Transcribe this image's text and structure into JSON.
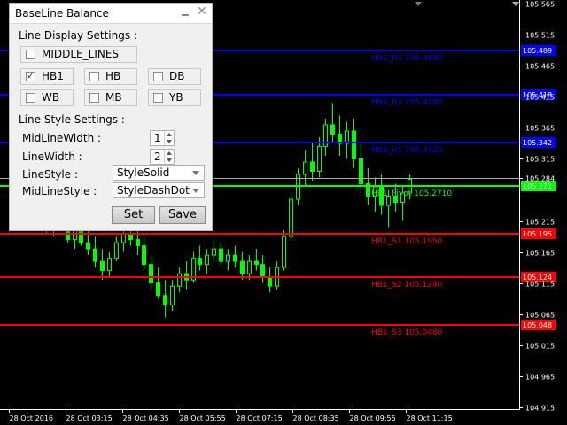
{
  "panel": {
    "title": "BaseLine Balance",
    "display_header": "Line Display Settings :",
    "middle_lines_label": "MIDDLE_LINES",
    "timeframes": [
      {
        "label": "HB1",
        "checked": true
      },
      {
        "label": "HB",
        "checked": false
      },
      {
        "label": "DB",
        "checked": false
      },
      {
        "label": "WB",
        "checked": false
      },
      {
        "label": "MB",
        "checked": false
      },
      {
        "label": "YB",
        "checked": false
      }
    ],
    "style_header": "Line Style Settings :",
    "mid_line_width_label": "MidLineWidth :",
    "mid_line_width_value": "1",
    "line_width_label": "LineWidth :",
    "line_width_value": "2",
    "line_style_label": "LineStyle :",
    "line_style_value": "StyleSolid",
    "mid_line_style_label": "MidLineStyle :",
    "mid_line_style_value": "StyleDashDot",
    "set_label": "Set",
    "save_label": "Save"
  },
  "chart_data": {
    "type": "candlestick",
    "colors": {
      "background": "#000000",
      "candle": "#00ff00",
      "resistance": "#0000ff",
      "pivot": "#00ff00",
      "support": "#ff0000",
      "current": "#aaaaaa"
    },
    "y_ticks": [
      "105.565",
      "105.515",
      "105.465",
      "105.415",
      "105.365",
      "105.315",
      "105.284",
      "105.215",
      "105.165",
      "105.115",
      "105.065",
      "105.015",
      "104.965",
      "104.915"
    ],
    "y_tick_values": [
      105.565,
      105.515,
      105.465,
      105.415,
      105.365,
      105.315,
      105.284,
      105.215,
      105.165,
      105.115,
      105.065,
      105.015,
      104.965,
      104.915
    ],
    "ylim": [
      104.912,
      105.571
    ],
    "x_ticks": [
      "28 Oct 2016",
      "28 Oct 03:15",
      "28 Oct 04:35",
      "28 Oct 05:55",
      "28 Oct 07:15",
      "28 Oct 08:35",
      "28 Oct 09:55",
      "28 Oct 11:15"
    ],
    "levels": [
      {
        "label": "HB1_R3 105.4890",
        "tag": "105.489",
        "value": 105.489,
        "kind": "resistance"
      },
      {
        "label": "HB1_R2 105.4180",
        "tag": "105.418",
        "value": 105.418,
        "kind": "resistance"
      },
      {
        "label": "HB1_R1 105.3420",
        "tag": "105.342",
        "value": 105.342,
        "kind": "resistance"
      },
      {
        "label": "HB1_Pivot 105.2710",
        "tag": "105.271",
        "value": 105.271,
        "kind": "pivot"
      },
      {
        "label": "HB1_S1 105.1950",
        "tag": "105.195",
        "value": 105.195,
        "kind": "support"
      },
      {
        "label": "HB1_S2 105.1240",
        "tag": "105.124",
        "value": 105.124,
        "kind": "support"
      },
      {
        "label": "HB1_S3 105.0480",
        "tag": "105.048",
        "value": 105.048,
        "kind": "support"
      }
    ],
    "current_price": 105.284,
    "candles": [
      [
        105.23,
        105.25,
        105.195,
        105.205
      ],
      [
        105.205,
        105.235,
        105.19,
        105.225
      ],
      [
        105.225,
        105.245,
        105.2,
        105.21
      ],
      [
        105.21,
        105.225,
        105.18,
        105.185
      ],
      [
        105.185,
        105.215,
        105.17,
        105.205
      ],
      [
        105.205,
        105.225,
        105.175,
        105.18
      ],
      [
        105.18,
        105.2,
        105.16,
        105.17
      ],
      [
        105.17,
        105.19,
        105.14,
        105.15
      ],
      [
        105.15,
        105.17,
        105.12,
        105.135
      ],
      [
        105.135,
        105.165,
        105.125,
        105.155
      ],
      [
        105.155,
        105.19,
        105.15,
        105.18
      ],
      [
        105.18,
        105.205,
        105.165,
        105.195
      ],
      [
        105.195,
        105.215,
        105.175,
        105.185
      ],
      [
        105.185,
        105.2,
        105.16,
        105.175
      ],
      [
        105.175,
        105.19,
        105.135,
        105.145
      ],
      [
        105.145,
        105.16,
        105.105,
        105.115
      ],
      [
        105.115,
        105.14,
        105.09,
        105.095
      ],
      [
        105.095,
        105.12,
        105.06,
        105.08
      ],
      [
        105.08,
        105.12,
        105.07,
        105.11
      ],
      [
        105.11,
        105.14,
        105.1,
        105.13
      ],
      [
        105.13,
        105.15,
        105.105,
        105.12
      ],
      [
        105.12,
        105.165,
        105.115,
        105.155
      ],
      [
        105.155,
        105.175,
        105.135,
        105.145
      ],
      [
        105.145,
        105.17,
        105.13,
        105.16
      ],
      [
        105.16,
        105.185,
        105.15,
        105.17
      ],
      [
        105.17,
        105.18,
        105.14,
        105.15
      ],
      [
        105.15,
        105.17,
        105.135,
        105.16
      ],
      [
        105.16,
        105.175,
        105.14,
        105.15
      ],
      [
        105.15,
        105.165,
        105.12,
        105.13
      ],
      [
        105.13,
        105.16,
        105.12,
        105.15
      ],
      [
        105.15,
        105.17,
        105.135,
        105.145
      ],
      [
        105.145,
        105.16,
        105.115,
        105.125
      ],
      [
        105.125,
        105.14,
        105.1,
        105.11
      ],
      [
        105.11,
        105.15,
        105.105,
        105.14
      ],
      [
        105.14,
        105.2,
        105.135,
        105.19
      ],
      [
        105.19,
        105.26,
        105.185,
        105.25
      ],
      [
        105.25,
        105.3,
        105.24,
        105.29
      ],
      [
        105.29,
        105.33,
        105.27,
        105.31
      ],
      [
        105.31,
        105.34,
        105.28,
        105.295
      ],
      [
        105.295,
        105.35,
        105.285,
        105.335
      ],
      [
        105.335,
        105.38,
        105.32,
        105.37
      ],
      [
        105.37,
        105.405,
        105.34,
        105.355
      ],
      [
        105.355,
        105.385,
        105.32,
        105.34
      ],
      [
        105.34,
        105.375,
        105.315,
        105.36
      ],
      [
        105.36,
        105.38,
        105.3,
        105.315
      ],
      [
        105.315,
        105.34,
        105.26,
        105.275
      ],
      [
        105.275,
        105.3,
        105.24,
        105.255
      ],
      [
        105.255,
        105.285,
        105.23,
        105.27
      ],
      [
        105.27,
        105.29,
        105.225,
        105.24
      ],
      [
        105.24,
        105.265,
        105.205,
        105.255
      ],
      [
        105.255,
        105.275,
        105.23,
        105.245
      ],
      [
        105.245,
        105.27,
        105.215,
        105.26
      ],
      [
        105.26,
        105.29,
        105.25,
        105.282
      ]
    ]
  }
}
